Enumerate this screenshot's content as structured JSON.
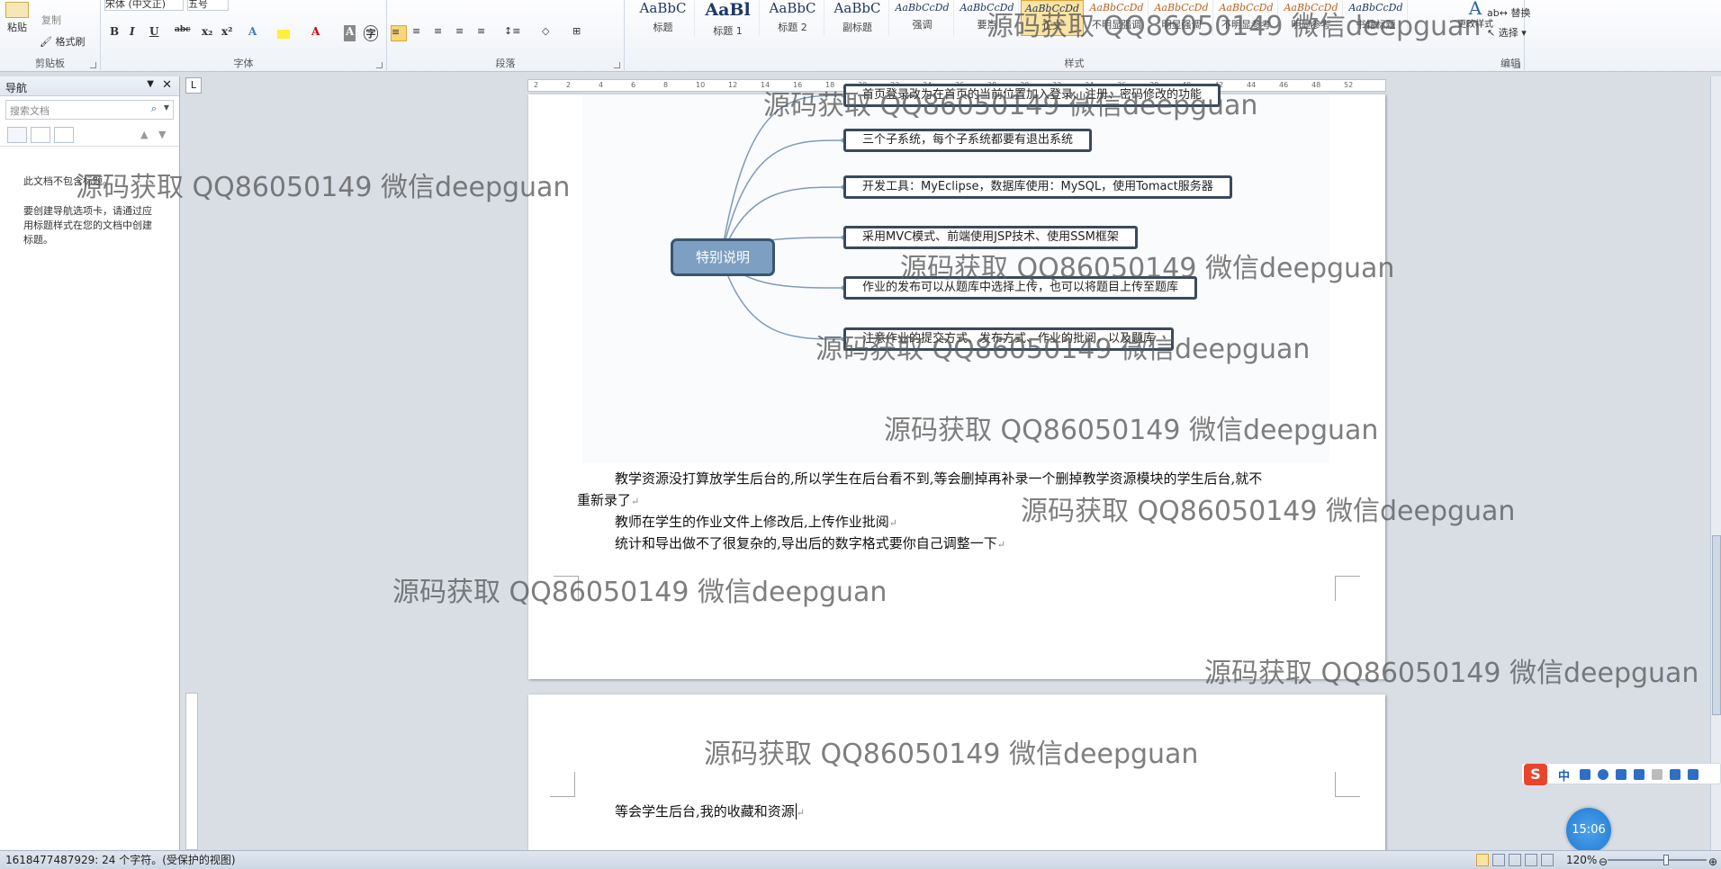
{
  "ribbon": {
    "clipboard": {
      "paste": "粘贴",
      "copy": "复制",
      "format_painter": "格式刷",
      "group_label": "剪贴板"
    },
    "font": {
      "font_name": "宋体 (中文正)",
      "font_size": "五号",
      "group_label": "字体"
    },
    "paragraph": {
      "group_label": "段落"
    },
    "styles": {
      "group_label": "样式",
      "tiles": [
        {
          "sample": "AaBbC",
          "name": "标题"
        },
        {
          "sample": "AaBl",
          "name": "标题 1"
        },
        {
          "sample": "AaBbC",
          "name": "标题 2"
        },
        {
          "sample": "AaBbC",
          "name": "副标题"
        },
        {
          "sample": "AaBbCcDd",
          "name": "强调"
        },
        {
          "sample": "AaBbCcDd",
          "name": "要点"
        },
        {
          "sample": "AaBbCcDd",
          "name": "正文"
        },
        {
          "sample": "AaBbCcDd",
          "name": "不明显强调"
        },
        {
          "sample": "AaBbCcDd",
          "name": "明显强调"
        },
        {
          "sample": "AaBbCcDd",
          "name": "不明显参考"
        },
        {
          "sample": "AaBbCcDd",
          "name": "明显参考"
        },
        {
          "sample": "AaBbCcDd",
          "name": "书籍标题"
        }
      ],
      "change_styles": "更改样式"
    },
    "editing": {
      "replace": "替换",
      "select": "选择",
      "group_label": "编辑"
    }
  },
  "nav": {
    "title": "导航",
    "search_placeholder": "搜索文档",
    "message1": "此文档不包含标题。",
    "message2": "要创建导航选项卡，请通过应用标题样式在您的文档中创建标题。"
  },
  "ruler": {
    "ticks": [
      "2",
      "2",
      "4",
      "6",
      "8",
      "10",
      "12",
      "14",
      "16",
      "18",
      "20",
      "22",
      "24",
      "26",
      "28",
      "30",
      "32",
      "34",
      "36",
      "38",
      "40",
      "42",
      "44",
      "46",
      "48",
      "52"
    ]
  },
  "mindmap": {
    "root": "特别说明",
    "branches": [
      "首页登录改为在首页的当前位置加入登录、注册、密码修改的功能",
      "三个子系统，每个子系统都要有退出系统",
      "开发工具：MyEclipse，数据库使用：MySQL，使用Tomact服务器",
      "采用MVC模式、前端使用JSP技术、使用SSM框架",
      "作业的发布可以从题库中选择上传，也可以将题目上传至题库",
      "注意作业的提交方式、发布方式、作业的批阅，以及题库"
    ]
  },
  "doc": {
    "p1_line1": "教学资源没打算放学生后台的,所以学生在后台看不到,等会删掉再补录一个删掉教学资源模块的学生后台,就不",
    "p1_line2": "重新录了",
    "p2": "教师在学生的作业文件上修改后,上传作业批阅",
    "p3": "统计和导出做不了很复杂的,导出后的数字格式要你自己调整一下",
    "page2_p1": "等会学生后台,我的收藏和资源"
  },
  "watermark": "源码获取 QQ86050149 微信deepguan",
  "status": {
    "left": "1618477487929: 24 个字符。(受保护的视图)",
    "zoom": "120%"
  },
  "ime": {
    "label": "中"
  },
  "clock": "15:06"
}
